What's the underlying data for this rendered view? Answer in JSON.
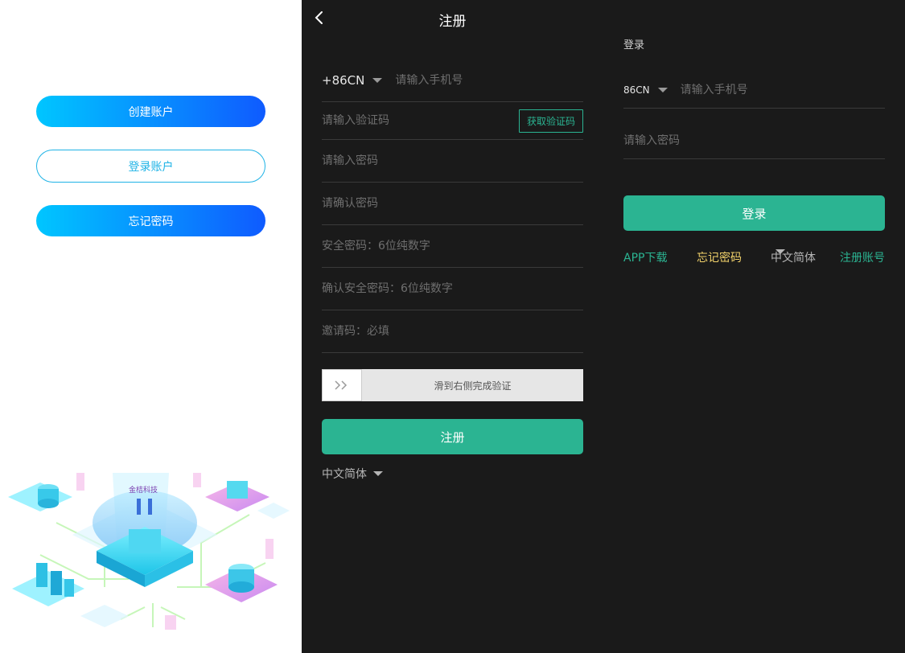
{
  "left": {
    "create_account": "创建账户",
    "login_account": "登录账户",
    "forgot_password": "忘记密码",
    "illustration_text": "金桔科技"
  },
  "register": {
    "title": "注册",
    "country_code": "+86CN",
    "phone_placeholder": "请输入手机号",
    "code_placeholder": "请输入验证码",
    "get_code": "获取验证码",
    "password_placeholder": "请输入密码",
    "confirm_password_placeholder": "请确认密码",
    "security_password_placeholder": "安全密码：6位纯数字",
    "confirm_security_placeholder": "确认安全密码：6位纯数字",
    "invite_placeholder": "邀请码：必填",
    "slider_text": "滑到右侧完成验证",
    "submit": "注册",
    "language": "中文简体"
  },
  "login": {
    "title": "登录",
    "country_code": "86CN",
    "phone_placeholder": "请输入手机号",
    "password_placeholder": "请输入密码",
    "submit": "登录",
    "app_download": "APP下载",
    "forgot_password": "忘记密码",
    "language": "中文简体",
    "register_account": "注册账号"
  },
  "colors": {
    "accent_green": "#2bb492",
    "accent_yellow": "#f3d36b",
    "gradient_start": "#00c6ff",
    "gradient_end": "#0f5bff",
    "background_dark": "#1a1a1a"
  }
}
